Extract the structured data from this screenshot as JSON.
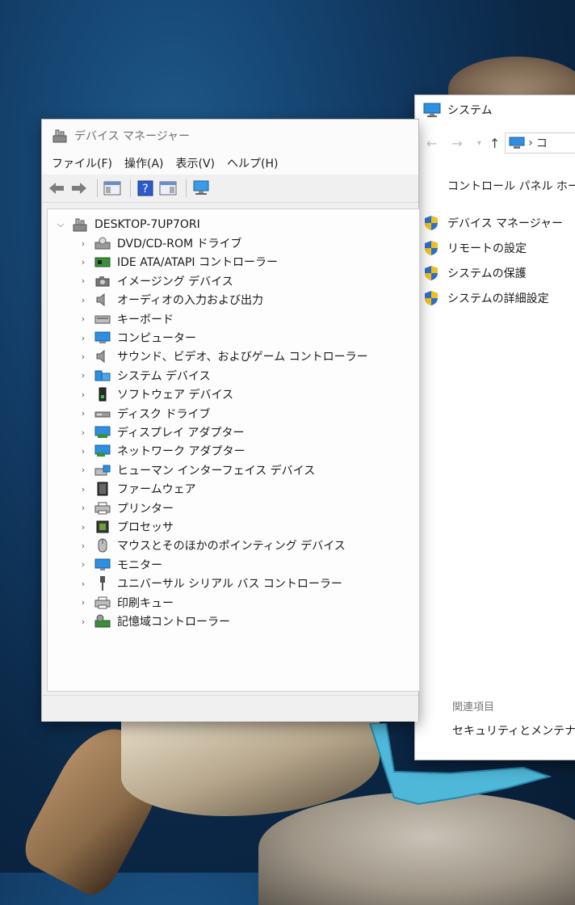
{
  "device_manager": {
    "title": "デバイス マネージャー",
    "menu": [
      "ファイル(F)",
      "操作(A)",
      "表示(V)",
      "ヘルプ(H)"
    ],
    "root": "DESKTOP-7UP7ORI",
    "categories": [
      {
        "label": "DVD/CD-ROM ドライブ",
        "icon": "dvd-drive-icon"
      },
      {
        "label": "IDE ATA/ATAPI コントローラー",
        "icon": "ide-controller-icon"
      },
      {
        "label": "イメージング デバイス",
        "icon": "camera-icon"
      },
      {
        "label": "オーディオの入力および出力",
        "icon": "speaker-icon"
      },
      {
        "label": "キーボード",
        "icon": "keyboard-icon"
      },
      {
        "label": "コンピューター",
        "icon": "computer-icon"
      },
      {
        "label": "サウンド、ビデオ、およびゲーム コントローラー",
        "icon": "speaker-icon"
      },
      {
        "label": "システム デバイス",
        "icon": "system-device-icon"
      },
      {
        "label": "ソフトウェア デバイス",
        "icon": "software-device-icon"
      },
      {
        "label": "ディスク ドライブ",
        "icon": "disk-drive-icon"
      },
      {
        "label": "ディスプレイ アダプター",
        "icon": "display-adapter-icon"
      },
      {
        "label": "ネットワーク アダプター",
        "icon": "network-adapter-icon"
      },
      {
        "label": "ヒューマン インターフェイス デバイス",
        "icon": "hid-icon"
      },
      {
        "label": "ファームウェア",
        "icon": "firmware-icon"
      },
      {
        "label": "プリンター",
        "icon": "printer-icon"
      },
      {
        "label": "プロセッサ",
        "icon": "processor-icon"
      },
      {
        "label": "マウスとそのほかのポインティング デバイス",
        "icon": "mouse-icon"
      },
      {
        "label": "モニター",
        "icon": "monitor-icon"
      },
      {
        "label": "ユニバーサル シリアル バス コントローラー",
        "icon": "usb-icon"
      },
      {
        "label": "印刷キュー",
        "icon": "printer-icon"
      },
      {
        "label": "記憶域コントローラー",
        "icon": "storage-controller-icon"
      }
    ]
  },
  "system_window": {
    "title": "システム",
    "address_glyph": "›",
    "address_text": "コ",
    "control_panel_home": "コントロール パネル ホーム",
    "links": [
      "デバイス マネージャー",
      "リモートの設定",
      "システムの保護",
      "システムの詳細設定"
    ],
    "related_heading": "関連項目",
    "security_link": "セキュリティとメンテナンス"
  },
  "colors": {
    "accent_blue": "#1e6fd0",
    "shield_blue": "#2f6fcf",
    "shield_yellow": "#f2c21b"
  }
}
